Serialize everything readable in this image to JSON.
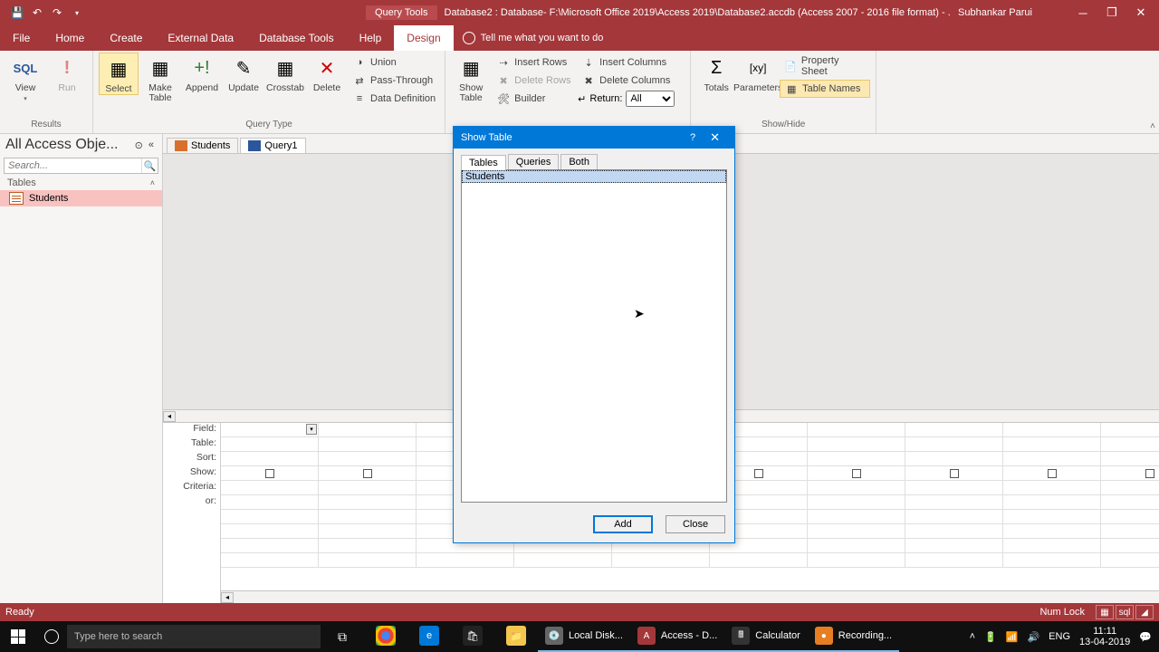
{
  "window": {
    "context_tab": "Query Tools",
    "title": "Database2 : Database- F:\\Microsoft Office 2019\\Access 2019\\Database2.accdb (Access 2007 - 2016 file format) - ...",
    "user": "Subhankar Parui"
  },
  "menu": {
    "file": "File",
    "home": "Home",
    "create": "Create",
    "external_data": "External Data",
    "database_tools": "Database Tools",
    "help": "Help",
    "design": "Design",
    "tellme": "Tell me what you want to do"
  },
  "ribbon": {
    "results": {
      "group": "Results",
      "view": "View",
      "run": "Run"
    },
    "querytype": {
      "group": "Query Type",
      "select": "Select",
      "maketable": "Make\nTable",
      "append": "Append",
      "update": "Update",
      "crosstab": "Crosstab",
      "delete": "Delete",
      "union": "Union",
      "passthrough": "Pass-Through",
      "datadef": "Data Definition"
    },
    "querysetup": {
      "show_table": "Show\nTable",
      "insert_rows": "Insert Rows",
      "delete_rows": "Delete Rows",
      "builder": "Builder",
      "insert_cols": "Insert Columns",
      "delete_cols": "Delete Columns",
      "return_lbl": "Return:",
      "return_val": "All"
    },
    "showhide": {
      "group": "Show/Hide",
      "totals": "Totals",
      "parameters": "Parameters",
      "property_sheet": "Property Sheet",
      "table_names": "Table Names"
    }
  },
  "nav": {
    "header": "All Access Obje...",
    "search_ph": "Search...",
    "cat": "Tables",
    "item": "Students"
  },
  "doc_tabs": {
    "t1": "Students",
    "t2": "Query1"
  },
  "grid_rows": {
    "field": "Field:",
    "table": "Table:",
    "sort": "Sort:",
    "show": "Show:",
    "criteria": "Criteria:",
    "or": "or:"
  },
  "dialog": {
    "title": "Show Table",
    "tab_tables": "Tables",
    "tab_queries": "Queries",
    "tab_both": "Both",
    "item": "Students",
    "add": "Add",
    "close": "Close"
  },
  "status": {
    "ready": "Ready",
    "numlock": "Num Lock"
  },
  "taskbar": {
    "search_ph": "Type here to search",
    "apps": {
      "localdisk": "Local Disk...",
      "access": "Access - D...",
      "calc": "Calculator",
      "rec": "Recording..."
    },
    "lang": "ENG",
    "time": "11:11",
    "date": "13-04-2019"
  }
}
